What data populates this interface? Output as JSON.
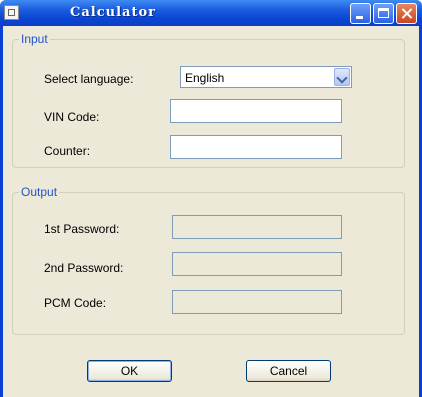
{
  "window": {
    "title": "Calculator"
  },
  "input_group": {
    "legend": "Input",
    "language_label": "Select language:",
    "language_value": "English",
    "vin_label": "VIN Code:",
    "vin_value": "",
    "counter_label": "Counter:",
    "counter_value": ""
  },
  "output_group": {
    "legend": "Output",
    "first_password_label": "1st Password:",
    "first_password_value": "",
    "second_password_label": "2nd Password:",
    "second_password_value": "",
    "pcm_label": "PCM Code:",
    "pcm_value": ""
  },
  "buttons": {
    "ok": "OK",
    "cancel": "Cancel"
  },
  "icons": {
    "app": "app-icon",
    "minimize": "minimize-icon",
    "maximize": "maximize-icon",
    "close": "close-icon",
    "dropdown": "chevron-down-icon"
  },
  "colors": {
    "titlebar": "#0a46d4",
    "dialog_background": "#ece9d8",
    "legend_text": "#2452c9",
    "close_button": "#c8461f"
  }
}
